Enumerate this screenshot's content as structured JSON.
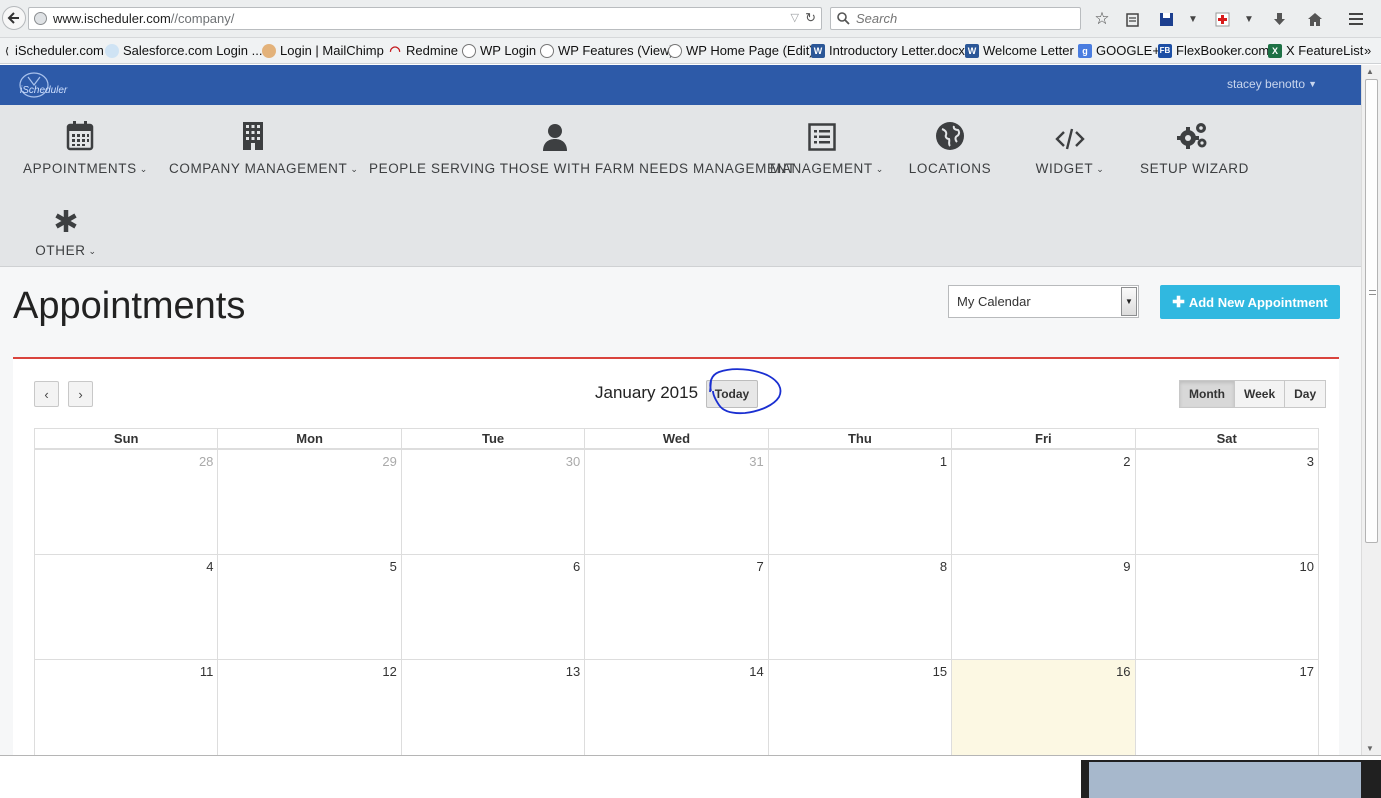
{
  "browser": {
    "url_host": "www.ischeduler.com",
    "url_path": "//company/",
    "search_placeholder": "Search"
  },
  "bookmarks": [
    {
      "label": "iScheduler.com",
      "icon": "ischeduler-icon"
    },
    {
      "label": "Salesforce.com Login ...",
      "icon": "cloud-icon"
    },
    {
      "label": "Login | MailChimp",
      "icon": "mailchimp-icon"
    },
    {
      "label": "Redmine",
      "icon": "redmine-icon"
    },
    {
      "label": "WP Login",
      "icon": "wordpress-icon"
    },
    {
      "label": "WP Features (View)",
      "icon": "wordpress-icon"
    },
    {
      "label": "WP Home Page (Edit)",
      "icon": "wordpress-icon"
    },
    {
      "label": "Introductory Letter.docx",
      "icon": "word-icon"
    },
    {
      "label": "Welcome Letter",
      "icon": "word-icon"
    },
    {
      "label": "GOOGLE+",
      "icon": "google-icon"
    },
    {
      "label": "FlexBooker.com",
      "icon": "flexbooker-icon"
    },
    {
      "label": "X FeatureList",
      "icon": "excel-icon"
    }
  ],
  "app": {
    "logo_text": "iScheduler",
    "user_name": "stacey benotto"
  },
  "nav": [
    {
      "label": "APPOINTMENTS",
      "icon": "calendar-icon",
      "caret": true
    },
    {
      "label": "COMPANY MANAGEMENT",
      "icon": "building-icon",
      "caret": true
    },
    {
      "label": "PEOPLE SERVING THOSE WITH FARM NEEDS MANAGEMENT",
      "icon": "user-icon",
      "caret": false
    },
    {
      "label": "MANAGEMENT",
      "icon": "list-icon",
      "caret": true
    },
    {
      "label": "LOCATIONS",
      "icon": "globe-icon",
      "caret": false
    },
    {
      "label": "WIDGET",
      "icon": "code-icon",
      "caret": true
    },
    {
      "label": "SETUP WIZARD",
      "icon": "gears-icon",
      "caret": false
    },
    {
      "label": "OTHER",
      "icon": "asterisk-icon",
      "caret": true
    }
  ],
  "page": {
    "title": "Appointments",
    "calendar_select": "My Calendar",
    "add_button": "Add New Appointment"
  },
  "calendar": {
    "prev": "‹",
    "next": "›",
    "title": "January 2015",
    "today_label": "Today",
    "views": [
      "Month",
      "Week",
      "Day"
    ],
    "active_view": "Month",
    "weekdays": [
      "Sun",
      "Mon",
      "Tue",
      "Wed",
      "Thu",
      "Fri",
      "Sat"
    ],
    "weeks": [
      [
        {
          "d": "28",
          "other": true
        },
        {
          "d": "29",
          "other": true
        },
        {
          "d": "30",
          "other": true
        },
        {
          "d": "31",
          "other": true
        },
        {
          "d": "1"
        },
        {
          "d": "2"
        },
        {
          "d": "3"
        }
      ],
      [
        {
          "d": "4"
        },
        {
          "d": "5"
        },
        {
          "d": "6"
        },
        {
          "d": "7"
        },
        {
          "d": "8"
        },
        {
          "d": "9"
        },
        {
          "d": "10"
        }
      ],
      [
        {
          "d": "11"
        },
        {
          "d": "12"
        },
        {
          "d": "13"
        },
        {
          "d": "14"
        },
        {
          "d": "15"
        },
        {
          "d": "16",
          "today": true
        },
        {
          "d": "17"
        }
      ]
    ]
  },
  "colors": {
    "brand_bar": "#2d5aa8",
    "accent_button": "#30b8e0",
    "panel_border": "#d9443d",
    "today_cell": "#fcf8e3",
    "annotation": "#1a2fd1"
  }
}
